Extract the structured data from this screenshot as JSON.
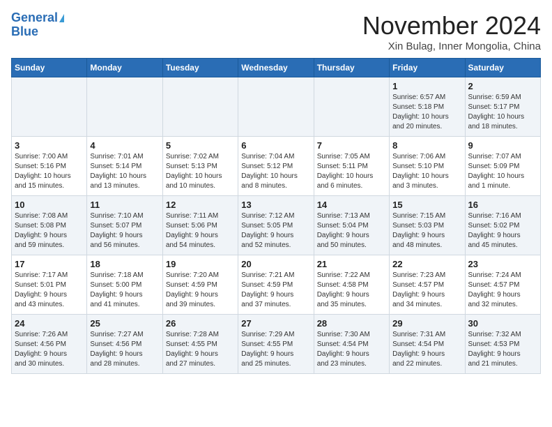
{
  "logo": {
    "line1": "General",
    "line2": "Blue"
  },
  "title": "November 2024",
  "location": "Xin Bulag, Inner Mongolia, China",
  "headers": [
    "Sunday",
    "Monday",
    "Tuesday",
    "Wednesday",
    "Thursday",
    "Friday",
    "Saturday"
  ],
  "weeks": [
    [
      {
        "day": "",
        "info": ""
      },
      {
        "day": "",
        "info": ""
      },
      {
        "day": "",
        "info": ""
      },
      {
        "day": "",
        "info": ""
      },
      {
        "day": "",
        "info": ""
      },
      {
        "day": "1",
        "info": "Sunrise: 6:57 AM\nSunset: 5:18 PM\nDaylight: 10 hours\nand 20 minutes."
      },
      {
        "day": "2",
        "info": "Sunrise: 6:59 AM\nSunset: 5:17 PM\nDaylight: 10 hours\nand 18 minutes."
      }
    ],
    [
      {
        "day": "3",
        "info": "Sunrise: 7:00 AM\nSunset: 5:16 PM\nDaylight: 10 hours\nand 15 minutes."
      },
      {
        "day": "4",
        "info": "Sunrise: 7:01 AM\nSunset: 5:14 PM\nDaylight: 10 hours\nand 13 minutes."
      },
      {
        "day": "5",
        "info": "Sunrise: 7:02 AM\nSunset: 5:13 PM\nDaylight: 10 hours\nand 10 minutes."
      },
      {
        "day": "6",
        "info": "Sunrise: 7:04 AM\nSunset: 5:12 PM\nDaylight: 10 hours\nand 8 minutes."
      },
      {
        "day": "7",
        "info": "Sunrise: 7:05 AM\nSunset: 5:11 PM\nDaylight: 10 hours\nand 6 minutes."
      },
      {
        "day": "8",
        "info": "Sunrise: 7:06 AM\nSunset: 5:10 PM\nDaylight: 10 hours\nand 3 minutes."
      },
      {
        "day": "9",
        "info": "Sunrise: 7:07 AM\nSunset: 5:09 PM\nDaylight: 10 hours\nand 1 minute."
      }
    ],
    [
      {
        "day": "10",
        "info": "Sunrise: 7:08 AM\nSunset: 5:08 PM\nDaylight: 9 hours\nand 59 minutes."
      },
      {
        "day": "11",
        "info": "Sunrise: 7:10 AM\nSunset: 5:07 PM\nDaylight: 9 hours\nand 56 minutes."
      },
      {
        "day": "12",
        "info": "Sunrise: 7:11 AM\nSunset: 5:06 PM\nDaylight: 9 hours\nand 54 minutes."
      },
      {
        "day": "13",
        "info": "Sunrise: 7:12 AM\nSunset: 5:05 PM\nDaylight: 9 hours\nand 52 minutes."
      },
      {
        "day": "14",
        "info": "Sunrise: 7:13 AM\nSunset: 5:04 PM\nDaylight: 9 hours\nand 50 minutes."
      },
      {
        "day": "15",
        "info": "Sunrise: 7:15 AM\nSunset: 5:03 PM\nDaylight: 9 hours\nand 48 minutes."
      },
      {
        "day": "16",
        "info": "Sunrise: 7:16 AM\nSunset: 5:02 PM\nDaylight: 9 hours\nand 45 minutes."
      }
    ],
    [
      {
        "day": "17",
        "info": "Sunrise: 7:17 AM\nSunset: 5:01 PM\nDaylight: 9 hours\nand 43 minutes."
      },
      {
        "day": "18",
        "info": "Sunrise: 7:18 AM\nSunset: 5:00 PM\nDaylight: 9 hours\nand 41 minutes."
      },
      {
        "day": "19",
        "info": "Sunrise: 7:20 AM\nSunset: 4:59 PM\nDaylight: 9 hours\nand 39 minutes."
      },
      {
        "day": "20",
        "info": "Sunrise: 7:21 AM\nSunset: 4:59 PM\nDaylight: 9 hours\nand 37 minutes."
      },
      {
        "day": "21",
        "info": "Sunrise: 7:22 AM\nSunset: 4:58 PM\nDaylight: 9 hours\nand 35 minutes."
      },
      {
        "day": "22",
        "info": "Sunrise: 7:23 AM\nSunset: 4:57 PM\nDaylight: 9 hours\nand 34 minutes."
      },
      {
        "day": "23",
        "info": "Sunrise: 7:24 AM\nSunset: 4:57 PM\nDaylight: 9 hours\nand 32 minutes."
      }
    ],
    [
      {
        "day": "24",
        "info": "Sunrise: 7:26 AM\nSunset: 4:56 PM\nDaylight: 9 hours\nand 30 minutes."
      },
      {
        "day": "25",
        "info": "Sunrise: 7:27 AM\nSunset: 4:56 PM\nDaylight: 9 hours\nand 28 minutes."
      },
      {
        "day": "26",
        "info": "Sunrise: 7:28 AM\nSunset: 4:55 PM\nDaylight: 9 hours\nand 27 minutes."
      },
      {
        "day": "27",
        "info": "Sunrise: 7:29 AM\nSunset: 4:55 PM\nDaylight: 9 hours\nand 25 minutes."
      },
      {
        "day": "28",
        "info": "Sunrise: 7:30 AM\nSunset: 4:54 PM\nDaylight: 9 hours\nand 23 minutes."
      },
      {
        "day": "29",
        "info": "Sunrise: 7:31 AM\nSunset: 4:54 PM\nDaylight: 9 hours\nand 22 minutes."
      },
      {
        "day": "30",
        "info": "Sunrise: 7:32 AM\nSunset: 4:53 PM\nDaylight: 9 hours\nand 21 minutes."
      }
    ]
  ]
}
